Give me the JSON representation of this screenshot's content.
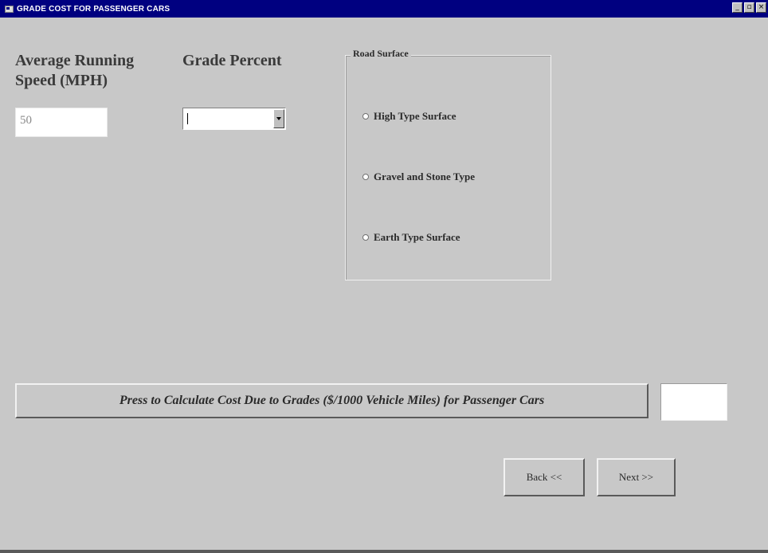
{
  "window": {
    "title": "GRADE COST FOR PASSENGER CARS",
    "controls": {
      "minimize": "_",
      "maximize": "▫",
      "close": "×"
    }
  },
  "speed": {
    "label": "Average Running Speed (MPH)",
    "value": "50"
  },
  "grade": {
    "label": "Grade Percent",
    "selected": ""
  },
  "road_surface": {
    "legend": "Road Surface",
    "options": [
      {
        "label": "High Type Surface",
        "selected": false
      },
      {
        "label": "Gravel and Stone Type",
        "selected": false
      },
      {
        "label": "Earth Type Surface",
        "selected": false
      }
    ]
  },
  "calculate": {
    "label": "Press to Calculate Cost Due to Grades ($/1000 Vehicle Miles) for Passenger Cars",
    "result": ""
  },
  "nav": {
    "back_label": "Back <<",
    "next_label": "Next >>"
  }
}
